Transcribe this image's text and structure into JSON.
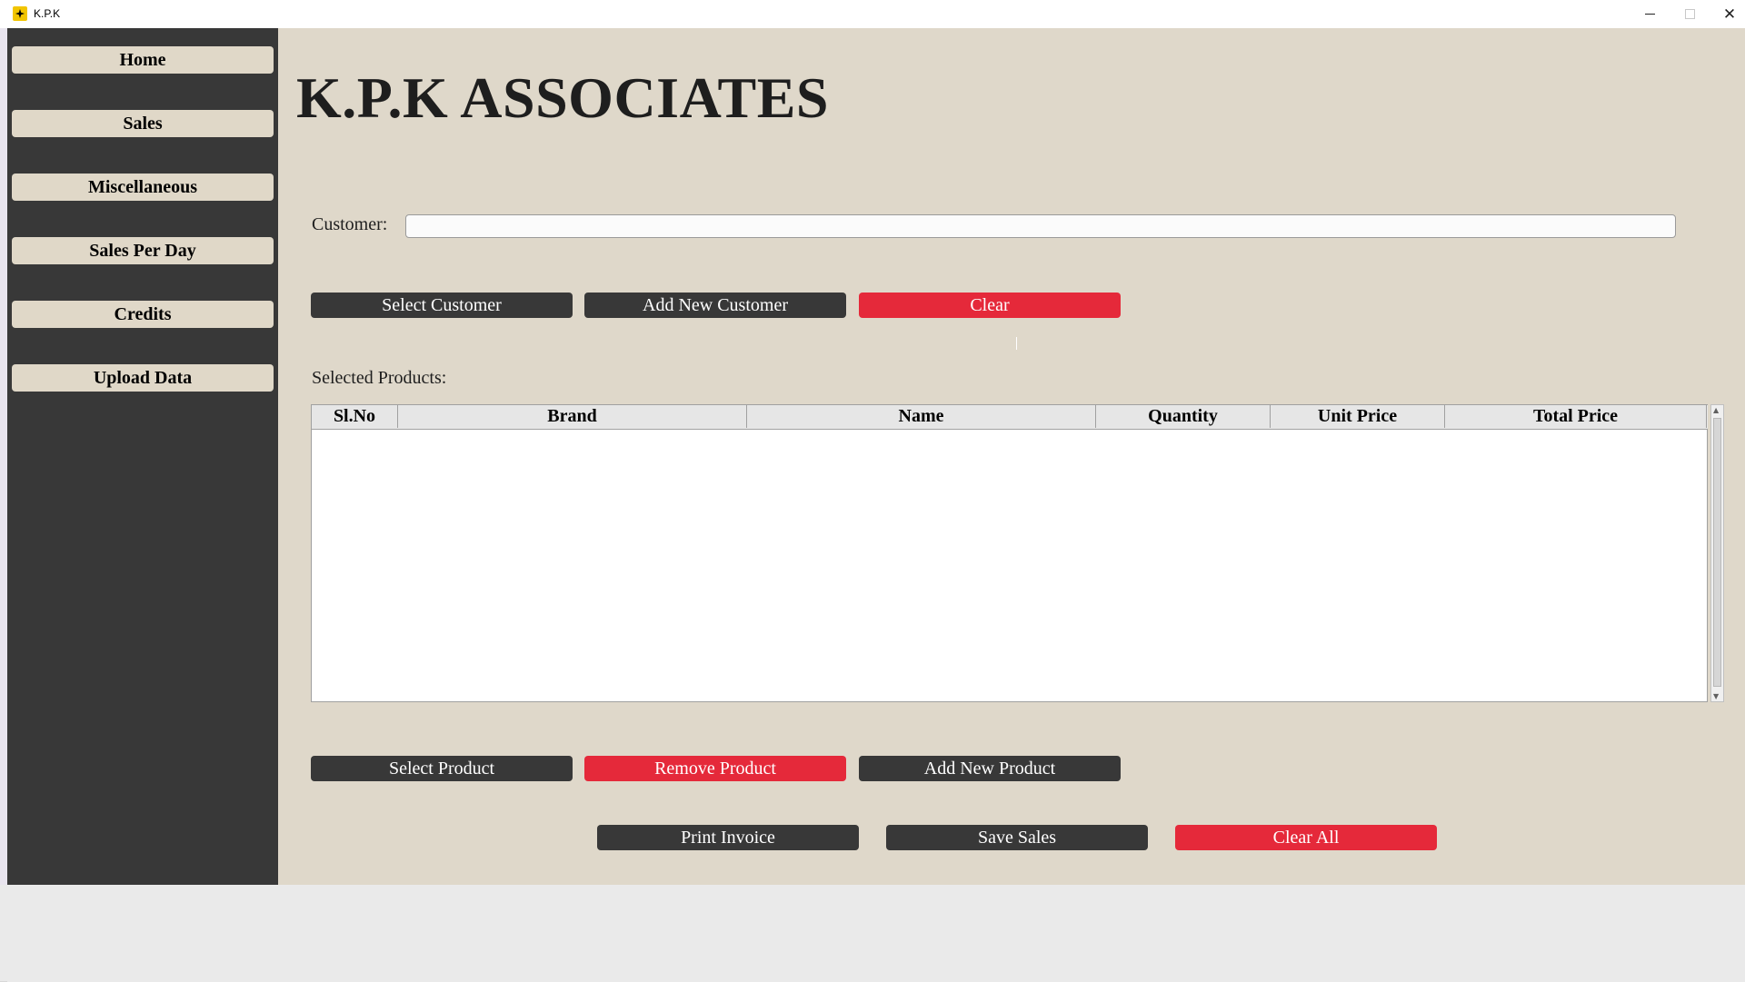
{
  "window": {
    "title": "K.P.K",
    "minimize_icon": "minimize-icon",
    "maximize_icon": "maximize-icon",
    "close_glyph": "✕"
  },
  "sidebar": {
    "items": [
      {
        "label": "Home"
      },
      {
        "label": "Sales"
      },
      {
        "label": "Miscellaneous"
      },
      {
        "label": "Sales Per Day"
      },
      {
        "label": "Credits"
      },
      {
        "label": "Upload Data"
      }
    ]
  },
  "main": {
    "brand_title": "K.P.K ASSOCIATES",
    "customer": {
      "label": "Customer:",
      "value": "",
      "placeholder": ""
    },
    "customer_actions": {
      "select": "Select Customer",
      "add_new": "Add New Customer",
      "clear": "Clear"
    },
    "selected_products_label": "Selected Products:",
    "table": {
      "columns": [
        "Sl.No",
        "Brand",
        "Name",
        "Quantity",
        "Unit Price",
        "Total Price"
      ],
      "rows": []
    },
    "product_actions": {
      "select": "Select Product",
      "remove": "Remove Product",
      "add_new": "Add New Product"
    },
    "final_actions": {
      "print": "Print Invoice",
      "save": "Save Sales",
      "clear_all": "Clear All"
    }
  },
  "colors": {
    "sidebar_bg": "#383838",
    "main_bg": "#dfd8ca",
    "nav_button_bg": "#e0d8c8",
    "dark_button": "#383838",
    "red_button": "#e5293a"
  }
}
